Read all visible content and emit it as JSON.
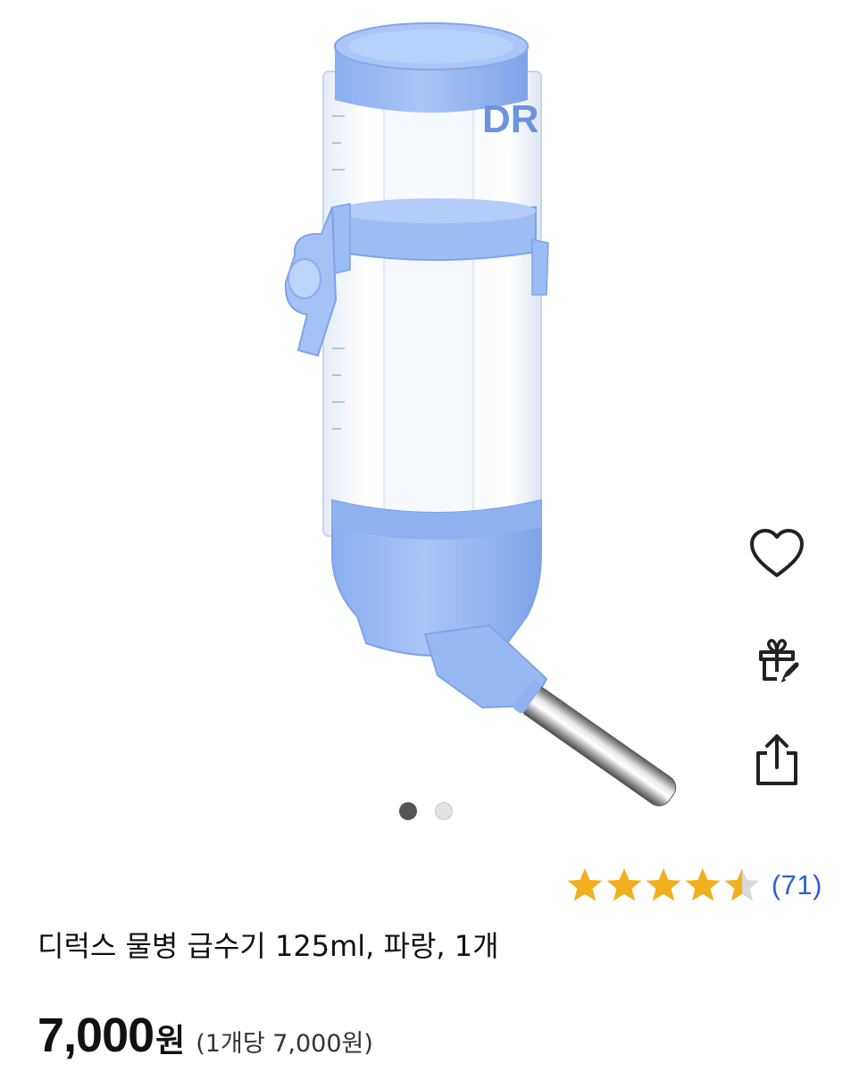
{
  "product": {
    "title": "디럭스 물병 급수기 125ml, 파랑, 1개",
    "price_number": "7,000",
    "price_currency": "원",
    "unit_price": "(1개당 7,000원)"
  },
  "rating": {
    "stars": 4.5,
    "max_stars": 5,
    "review_count": "(71)",
    "star_color": "#f2b01e",
    "empty_star_color": "#d9d9d9"
  },
  "gallery": {
    "total_images": 2,
    "active_index": 0,
    "bottle_label_text": "DR"
  },
  "actions": {
    "wishlist_icon": "heart-icon",
    "gift_icon": "gift-rocket-icon",
    "share_icon": "share-icon"
  },
  "colors": {
    "accent_blue": "#8fb4f0",
    "review_link": "#2f5fcc"
  }
}
